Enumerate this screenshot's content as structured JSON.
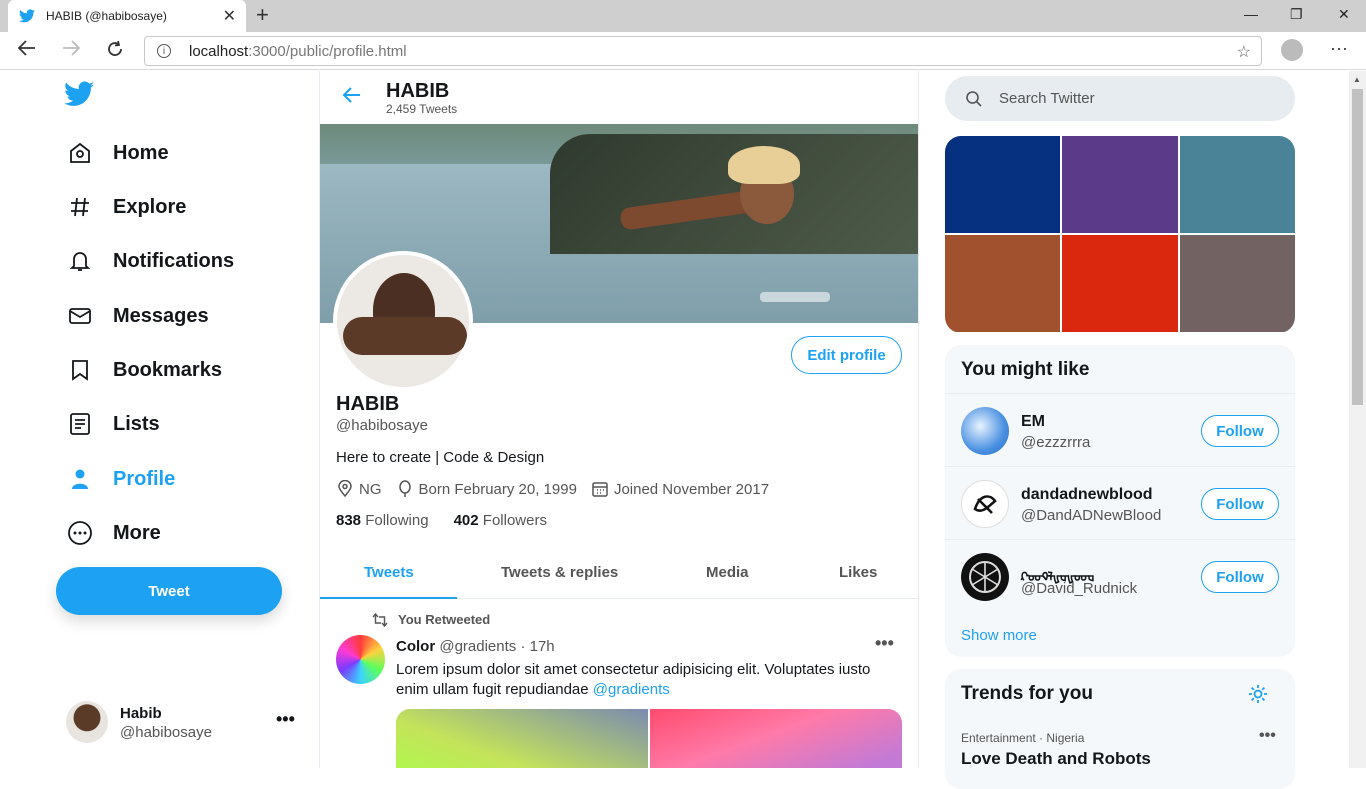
{
  "browser": {
    "tab_title": "HABIB (@habibosaye)",
    "tab_close": "✕",
    "new_tab": "+",
    "url_host": "localhost",
    "url_rest": ":3000/public/profile.html",
    "win_min": "—",
    "win_max": "❐",
    "win_close": "✕"
  },
  "sidebar": {
    "items": [
      {
        "label": "Home",
        "icon": "home-icon"
      },
      {
        "label": "Explore",
        "icon": "hashtag-icon"
      },
      {
        "label": "Notifications",
        "icon": "bell-icon"
      },
      {
        "label": "Messages",
        "icon": "mail-icon"
      },
      {
        "label": "Bookmarks",
        "icon": "bookmark-icon"
      },
      {
        "label": "Lists",
        "icon": "list-icon"
      },
      {
        "label": "Profile",
        "icon": "user-icon",
        "active": true
      },
      {
        "label": "More",
        "icon": "more-circle-icon"
      }
    ],
    "tweet_button": "Tweet",
    "account": {
      "name": "Habib",
      "handle": "@habibosaye",
      "menu": "•••"
    }
  },
  "header": {
    "name": "HABIB",
    "tweet_count": "2,459 Tweets"
  },
  "profile": {
    "edit_button": "Edit profile",
    "name": "HABIB",
    "handle": "@habibosaye",
    "bio": "Here to create | Code & Design",
    "location": "NG",
    "birthday": "Born February 20, 1999",
    "joined": "Joined November 2017",
    "following_count": "838",
    "following_label": "Following",
    "followers_count": "402",
    "followers_label": "Followers"
  },
  "tabs": [
    "Tweets",
    "Tweets & replies",
    "Media",
    "Likes"
  ],
  "tweet": {
    "retweet_label": "You Retweeted",
    "author": "Color",
    "handle_time": "@gradients · 17h",
    "text": "Lorem ipsum dolor sit amet consectetur adipisicing elit. Voluptates iusto enim ullam fugit repudiandae ",
    "link": "@gradients",
    "menu": "•••"
  },
  "right": {
    "search_placeholder": "Search Twitter",
    "palette": [
      "#063180",
      "#5b3a8a",
      "#4a8298",
      "#a2512e",
      "#d9280e",
      "#726262"
    ],
    "might_like_title": "You might like",
    "suggestions": [
      {
        "name": "EM",
        "handle": "@ezzzrrra",
        "button": "Follow"
      },
      {
        "name": "dandadnewblood",
        "handle": "@DandADNewBlood",
        "button": "Follow"
      },
      {
        "name": "ᡘ᠊ᡂᡐᡀᡆᡁᡂᡆ",
        "handle": "@David_Rudnick",
        "button": "Follow"
      }
    ],
    "show_more": "Show more",
    "trends_title": "Trends for you",
    "trend": {
      "category": "Entertainment · Nigeria",
      "name": "Love Death and Robots",
      "menu": "•••"
    }
  },
  "colors": {
    "accent": "#1da1f2"
  }
}
